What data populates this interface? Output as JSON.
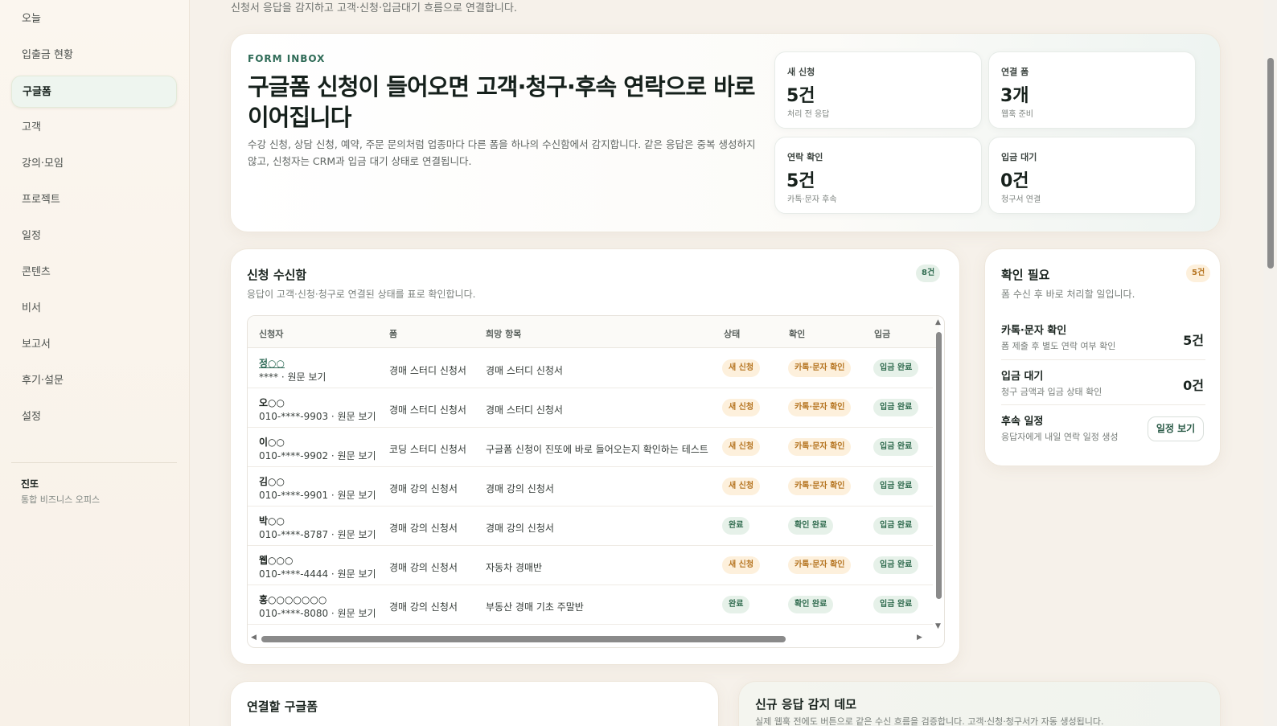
{
  "sidebar": {
    "items": [
      {
        "label": "오늘"
      },
      {
        "label": "입출금 현황"
      },
      {
        "label": "구글폼"
      },
      {
        "label": "고객"
      },
      {
        "label": "강의·모임"
      },
      {
        "label": "프로젝트"
      },
      {
        "label": "일정"
      },
      {
        "label": "콘텐츠"
      },
      {
        "label": "비서"
      },
      {
        "label": "보고서"
      },
      {
        "label": "후기·설문"
      },
      {
        "label": "설정"
      }
    ],
    "active": "구글폼",
    "brand": {
      "name": "진또",
      "sub": "통합 비즈니스 오피스"
    }
  },
  "page": {
    "top_desc": "신청서 응답을 감지하고 고객·신청·입금대기 흐름으로 연결합니다."
  },
  "hero": {
    "eyebrow": "FORM INBOX",
    "title": "구글폼 신청이 들어오면 고객·청구·후속 연락으로 바로 이어집니다",
    "desc": "수강 신청, 상담 신청, 예약, 주문 문의처럼 업종마다 다른 폼을 하나의 수신함에서 감지합니다. 같은 응답은 중복 생성하지 않고, 신청자는 CRM과 입금 대기 상태로 연결됩니다.",
    "stats": [
      {
        "label": "새 신청",
        "value": "5건",
        "sub": "처리 전 응답"
      },
      {
        "label": "연결 폼",
        "value": "3개",
        "sub": "웹훅 준비"
      },
      {
        "label": "연락 확인",
        "value": "5건",
        "sub": "카톡·문자 후속"
      },
      {
        "label": "입금 대기",
        "value": "0건",
        "sub": "청구서 연결"
      }
    ]
  },
  "inbox": {
    "title": "신청 수신함",
    "subtitle": "응답이 고객·신청·청구로 연결된 상태를 표로 확인합니다.",
    "count": "8건",
    "columns": [
      "신청자",
      "폼",
      "희망 항목",
      "상태",
      "확인",
      "입금"
    ],
    "rows": [
      {
        "name": "정○○",
        "phone": "**** · 원문 보기",
        "form": "경매 스터디 신청서",
        "item": "경매 스터디 신청서",
        "status": "새 신청",
        "check": "카톡·문자 확인",
        "pay": "입금 완료"
      },
      {
        "name": "오○○",
        "phone": "010-****-9903 · 원문 보기",
        "form": "경매 스터디 신청서",
        "item": "경매 스터디 신청서",
        "status": "새 신청",
        "check": "카톡·문자 확인",
        "pay": "입금 완료"
      },
      {
        "name": "이○○",
        "phone": "010-****-9902 · 원문 보기",
        "form": "코딩 스터디 신청서",
        "item": "구글폼 신청이 진또에 바로 들어오는지 확인하는 테스트",
        "status": "새 신청",
        "check": "카톡·문자 확인",
        "pay": "입금 완료"
      },
      {
        "name": "김○○",
        "phone": "010-****-9901 · 원문 보기",
        "form": "경매 강의 신청서",
        "item": "경매 강의 신청서",
        "status": "새 신청",
        "check": "카톡·문자 확인",
        "pay": "입금 완료"
      },
      {
        "name": "박○○",
        "phone": "010-****-8787 · 원문 보기",
        "form": "경매 강의 신청서",
        "item": "경매 강의 신청서",
        "status": "완료",
        "check": "확인 완료",
        "pay": "입금 완료"
      },
      {
        "name": "웹○○○",
        "phone": "010-****-4444 · 원문 보기",
        "form": "경매 강의 신청서",
        "item": "자동차 경매반",
        "status": "새 신청",
        "check": "카톡·문자 확인",
        "pay": "입금 완료"
      },
      {
        "name": "홍○○○○○○○",
        "phone": "010-****-8080 · 원문 보기",
        "form": "경매 강의 신청서",
        "item": "부동산 경매 기초 주말반",
        "status": "완료",
        "check": "확인 완료",
        "pay": "입금 완료"
      }
    ]
  },
  "check": {
    "title": "확인 필요",
    "subtitle": "폼 수신 후 바로 처리할 일입니다.",
    "count": "5건",
    "items": [
      {
        "title": "카톡·문자 확인",
        "sub": "폼 제출 후 별도 연락 여부 확인",
        "value": "5건"
      },
      {
        "title": "입금 대기",
        "sub": "청구 금액과 입금 상태 확인",
        "value": "0건"
      },
      {
        "title": "후속 일정",
        "sub": "응답자에게 내일 연락 일정 생성",
        "button": "일정 보기"
      }
    ]
  },
  "connect": {
    "title": "연결할 구글폼"
  },
  "demo": {
    "title": "신규 응답 감지 데모",
    "desc": "실제 웹훅 전에도 버튼으로 같은 수신 흐름을 검증합니다. 고객·신청·청구서가 자동 생성됩니다."
  },
  "colors": {
    "accent": "#2f6b57",
    "amber": "#b57420",
    "amber_bg": "#fdf0dc",
    "green_bg": "#e6f1e9"
  },
  "icons": [
    "scroll-up-arrow-icon",
    "scroll-down-arrow-icon",
    "scroll-left-arrow-icon",
    "scroll-right-arrow-icon"
  ]
}
